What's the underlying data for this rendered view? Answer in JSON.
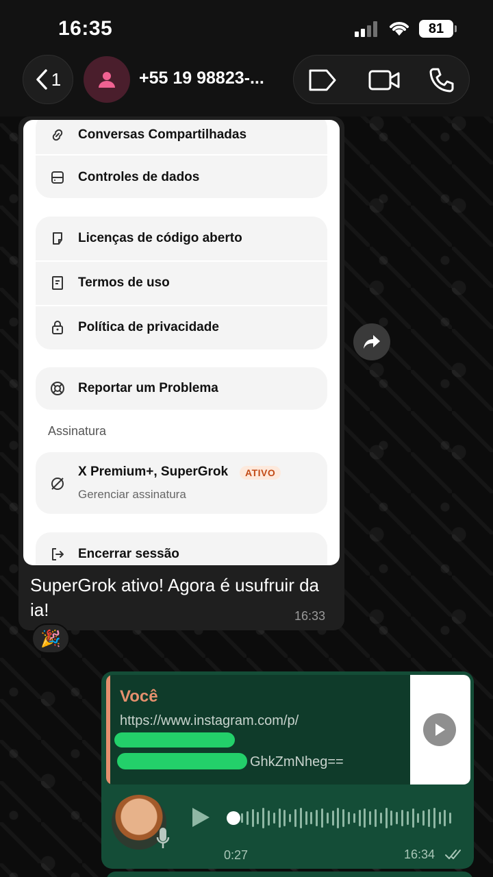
{
  "status_bar": {
    "time": "16:35",
    "battery": "81"
  },
  "header": {
    "back_count": "1",
    "contact_name": "+55 19 98823-..."
  },
  "settings_screenshot": {
    "items": {
      "shared": "Conversas Compartilhadas",
      "data_controls": "Controles de dados",
      "licenses": "Licenças de código aberto",
      "terms": "Termos de uso",
      "privacy": "Política de privacidade",
      "report": "Reportar um Problema",
      "logout": "Encerrar sessão"
    },
    "subscription_section": "Assinatura",
    "subscription": {
      "title": "X Premium+, SuperGrok",
      "badge": "ATIVO",
      "caption": "Gerenciar assinatura"
    }
  },
  "incoming_message": {
    "text": "SuperGrok ativo! Agora é usufruir da ia!",
    "time": "16:33",
    "reaction": "🎉"
  },
  "outgoing_message": {
    "quote_author": "Você",
    "quote_line1": "https://www.instagram.com/p/",
    "quote_line3": "GhkZmNheg==",
    "voice_duration": "0:27",
    "time": "16:34"
  },
  "colors": {
    "outgoing_bubble": "#144d37",
    "quote_accent": "#e6906e",
    "badge_text": "#c24b17"
  }
}
